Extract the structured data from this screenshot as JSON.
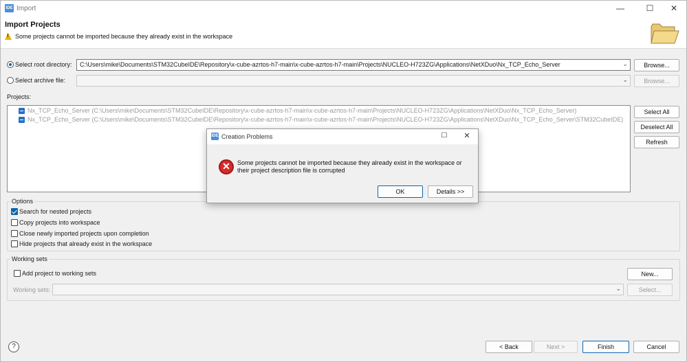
{
  "window": {
    "title": "Import",
    "app_badge": "IDE",
    "controls": {
      "minimize": "—",
      "maximize": "☐",
      "close": "✕"
    }
  },
  "header": {
    "title": "Import Projects",
    "message": "Some projects cannot be imported because they already exist in the workspace"
  },
  "source": {
    "root_label": "Select root directory:",
    "root_value": "C:\\Users\\mike\\Documents\\STM32CubeIDE\\Repository\\x-cube-azrtos-h7-main\\x-cube-azrtos-h7-main\\Projects\\NUCLEO-H723ZG\\Applications\\NetXDuo\\Nx_TCP_Echo_Server",
    "archive_label": "Select archive file:",
    "archive_value": "",
    "browse_label": "Browse...",
    "browse_archive_label": "Browse..."
  },
  "projects": {
    "label": "Projects:",
    "items": [
      "Nx_TCP_Echo_Server (C:\\Users\\mike\\Documents\\STM32CubeIDE\\Repository\\x-cube-azrtos-h7-main\\x-cube-azrtos-h7-main\\Projects\\NUCLEO-H723ZG\\Applications\\NetXDuo\\Nx_TCP_Echo_Server)",
      "Nx_TCP_Echo_Server (C:\\Users\\mike\\Documents\\STM32CubeIDE\\Repository\\x-cube-azrtos-h7-main\\x-cube-azrtos-h7-main\\Projects\\NUCLEO-H723ZG\\Applications\\NetXDuo\\Nx_TCP_Echo_Server\\STM32CubeIDE)"
    ],
    "select_all": "Select All",
    "deselect_all": "Deselect All",
    "refresh": "Refresh"
  },
  "options": {
    "title": "Options",
    "search_nested": "Search for nested projects",
    "copy_into": "Copy projects into workspace",
    "close_new": "Close newly imported projects upon completion",
    "hide_existing": "Hide projects that already exist in the workspace"
  },
  "working_sets": {
    "title": "Working sets",
    "add_label": "Add project to working sets",
    "new_label": "New...",
    "sets_label": "Working sets:",
    "select_label": "Select..."
  },
  "footer": {
    "help": "?",
    "back": "< Back",
    "next": "Next >",
    "finish": "Finish",
    "cancel": "Cancel"
  },
  "dialog": {
    "title": "Creation Problems",
    "message": "Some projects cannot be imported because they already exist in the workspace or their project description file is corrupted",
    "ok": "OK",
    "details": "Details >>"
  }
}
